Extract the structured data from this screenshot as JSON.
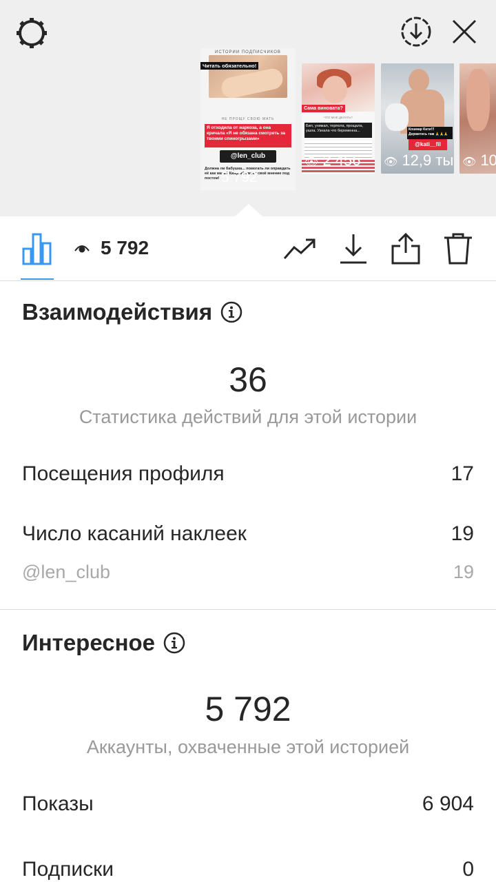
{
  "stories": [
    {
      "header": "ИСТОРИИ ПОДПИСЧИКОВ",
      "tag": "Читать обязательно!",
      "subheading": "НЕ ПРОЩУ СВОЮ МАТЬ",
      "red_text": "Я отходила от наркоза, а она кричала «Я не обязана смотреть за твоими спиногрызами»",
      "mention": "@len_club",
      "body": "Должна ли бабушка... помогать ли оправдать её как мать? Каждый имеет своё мнение под постом!",
      "views": "5 792"
    },
    {
      "red_text": "Сама виновата?",
      "subheading": "ЧТО МНЕ ДЕЛАТЬ?",
      "black_text": "Бил, унижал, терпела, прощала, ушла. Узнала что беременна...",
      "views": "2 456"
    },
    {
      "black_text": "Кошмар Кати!!! Держитесь там 🙏🙏🙏",
      "mention": "@kati__fil",
      "views": "12,9 ты"
    },
    {
      "views": "10"
    }
  ],
  "toolbar": {
    "views": "5 792"
  },
  "interactions": {
    "title": "Взаимодействия",
    "total": "36",
    "subtitle": "Статистика действий для этой истории",
    "rows": [
      {
        "label": "Посещения профиля",
        "value": "17"
      },
      {
        "label": "Число касаний наклеек",
        "value": "19"
      },
      {
        "label": "@len_club",
        "value": "19"
      }
    ]
  },
  "discovery": {
    "title": "Интересное",
    "total": "5 792",
    "subtitle": "Аккаунты, охваченные этой историей",
    "rows": [
      {
        "label": "Показы",
        "value": "6 904"
      },
      {
        "label": "Подписки",
        "value": "0"
      }
    ]
  },
  "colors": {
    "accent": "#3897f0",
    "text": "#262626",
    "muted": "#999999",
    "story_red": "#e4283a"
  },
  "icons": [
    "settings-icon",
    "download-circle-icon",
    "close-icon",
    "bar-chart-icon",
    "eye-icon",
    "trending-icon",
    "download-icon",
    "share-icon",
    "trash-icon",
    "info-icon"
  ]
}
